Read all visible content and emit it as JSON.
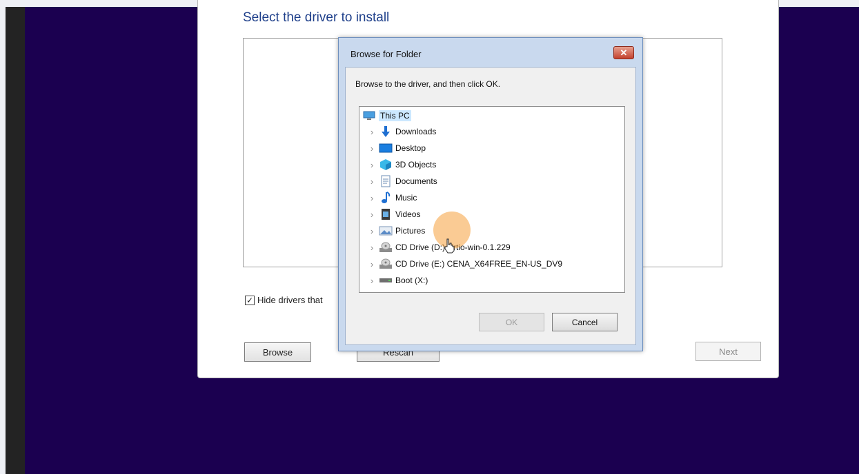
{
  "setup": {
    "title": "Select the driver to install",
    "hide_drivers_label": "Hide drivers that",
    "hide_drivers_checked": true,
    "browse_label": "Browse",
    "rescan_label": "Rescan",
    "next_label": "Next"
  },
  "dialog": {
    "title": "Browse for Folder",
    "close_glyph": "✕",
    "instruction": "Browse to the driver, and then click OK.",
    "ok_label": "OK",
    "cancel_label": "Cancel",
    "tree": [
      {
        "label": "This PC",
        "icon": "pc-icon",
        "selected": true
      },
      {
        "label": "Downloads",
        "icon": "download-icon"
      },
      {
        "label": "Desktop",
        "icon": "desktop-icon"
      },
      {
        "label": "3D Objects",
        "icon": "cube-icon"
      },
      {
        "label": "Documents",
        "icon": "document-icon"
      },
      {
        "label": "Music",
        "icon": "music-icon"
      },
      {
        "label": "Videos",
        "icon": "video-icon"
      },
      {
        "label": "Pictures",
        "icon": "picture-icon"
      },
      {
        "label": "CD Drive (D:) virtio-win-0.1.229",
        "icon": "cd-drive-icon"
      },
      {
        "label": "CD Drive (E:) CENA_X64FREE_EN-US_DV9",
        "icon": "cd-drive-icon"
      },
      {
        "label": "Boot (X:)",
        "icon": "drive-icon"
      }
    ]
  },
  "colors": {
    "background": "#1b0050",
    "title_blue": "#1e3f8a",
    "selection": "#cce8ff",
    "highlight": "#f5a03c"
  }
}
